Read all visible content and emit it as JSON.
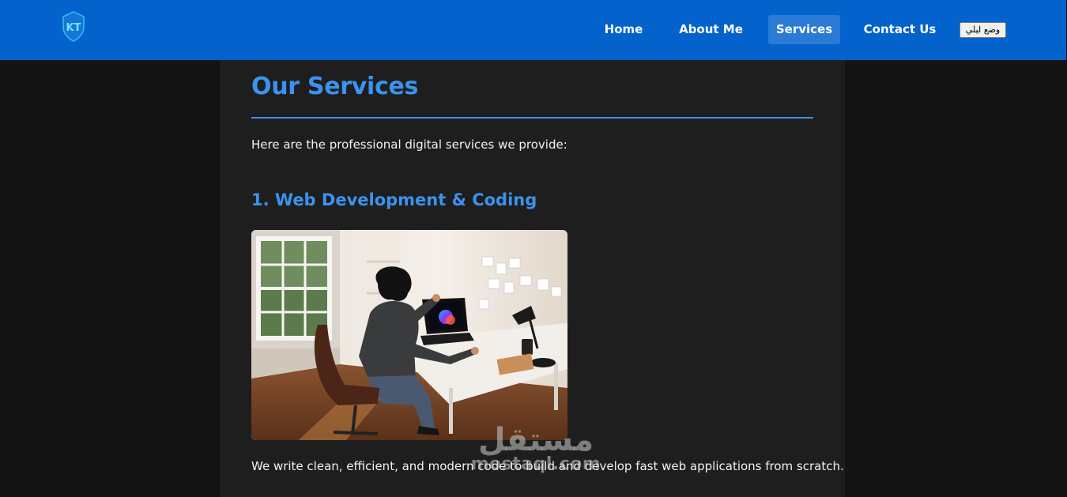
{
  "nav": {
    "logo_text": "KT",
    "links": [
      {
        "label": "Home"
      },
      {
        "label": "About Me"
      },
      {
        "label": "Services",
        "active": true
      },
      {
        "label": "Contact Us"
      }
    ],
    "mode_toggle_label": "وضع ليلي"
  },
  "main": {
    "title": "Our Services",
    "intro": "Here are the professional digital services we provide:",
    "services": [
      {
        "heading": "1. Web Development & Coding",
        "description": "We write clean, efficient, and modern code to build and develop fast web applications from scratch."
      }
    ]
  },
  "watermark": {
    "arabic": "مستقل",
    "latin": "mostaql.com"
  },
  "colors": {
    "navbar": "#0362cb",
    "accent": "#3a93f0",
    "content_bg": "#1e1e1e",
    "page_bg": "#131313"
  }
}
